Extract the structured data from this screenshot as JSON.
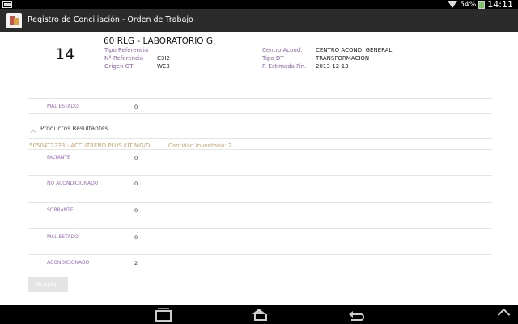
{
  "status": {
    "battery_percent": "54%",
    "time": "14:11"
  },
  "app": {
    "title": "Registro de Conciliación - Orden de Trabajo"
  },
  "header": {
    "number": "14",
    "title": "60 RLG - LABORATORIO G.",
    "fields_left": [
      {
        "label": "Tipo Referencia",
        "value": ""
      },
      {
        "label": "N° Referencia",
        "value": "C3I2"
      },
      {
        "label": "Origen OT",
        "value": "WE3"
      }
    ],
    "fields_right": [
      {
        "label": "Centro Acond.",
        "value": "CENTRO ACOND. GENERAL"
      },
      {
        "label": "Tipo DT",
        "value": "TRANSFORMACION"
      },
      {
        "label": "F. Estimada Fin.",
        "value": "2013-12-13"
      }
    ]
  },
  "top_rows": [
    {
      "label": "MAL ESTADO",
      "value": "0"
    }
  ],
  "section": {
    "title": "Productos Resultantes"
  },
  "product": {
    "name": "50504T2223 - ACCUTREND PLUS KIT MG/DL",
    "quantity_label": "Cantidad Inventario:",
    "quantity_value": "2"
  },
  "product_rows": [
    {
      "label": "FALTANTE",
      "value": "0"
    },
    {
      "label": "NO ACONDICIONADO",
      "value": "0"
    },
    {
      "label": "SOBRANTE",
      "value": "0"
    },
    {
      "label": "MAL ESTADO",
      "value": "0"
    },
    {
      "label": "ACONDICIONADO",
      "value": "2"
    }
  ],
  "actions": {
    "accept_label": "Aceptar"
  }
}
